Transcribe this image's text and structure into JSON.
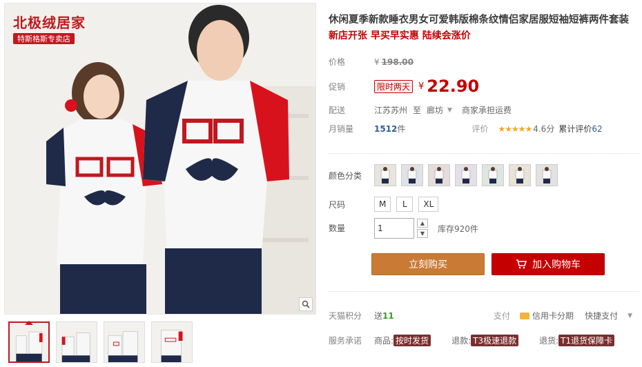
{
  "brand": {
    "name": "北极绒居家",
    "store": "特斯格斯专卖店"
  },
  "product": {
    "title": "休闲夏季新款睡衣男女可爱韩版棉条纹情侣家居服短袖短裤两件套装",
    "promo_line": "新店开张 早买早实惠 陆续会涨价"
  },
  "price": {
    "label": "价格",
    "currency": "¥",
    "original": "198.00"
  },
  "promo": {
    "label": "促销",
    "tag": "限时两天",
    "currency": "¥",
    "value": "22.90"
  },
  "shipping": {
    "label": "配送",
    "from": "江苏苏州",
    "to_word": "至",
    "to": "廊坊",
    "fee": "商家承担运费"
  },
  "sales": {
    "label": "月销量",
    "count": "1512",
    "unit": "件",
    "rating_label": "评价",
    "stars": "★★★★★",
    "score": "4.6分",
    "reviews_label": "累计评价",
    "reviews_count": "62"
  },
  "color": {
    "label": "颜色分类",
    "swatch_count": 7
  },
  "size": {
    "label": "尺码",
    "options": [
      "M",
      "L",
      "XL"
    ]
  },
  "quantity": {
    "label": "数量",
    "value": "1",
    "up": "▲",
    "down": "▼",
    "stock": "库存920件"
  },
  "actions": {
    "buy": "立刻购买",
    "cart": "加入购物车"
  },
  "points": {
    "label": "天猫积分",
    "send": "送",
    "value": "11",
    "pay_label": "支付",
    "credit": "信用卡分期",
    "quick_pay": "快捷支付"
  },
  "service": {
    "label": "服务承诺",
    "goods": "商品:",
    "goods_tag": "按时发货",
    "refund": "退款:",
    "refund_tag": "T3极速退款",
    "return": "退货:",
    "return_tag": "T1退货保障卡"
  },
  "colors": {
    "accent": "#c40000",
    "buy": "#c97a35",
    "brand": "#c0181f"
  },
  "icons": {
    "zoom": "magnifier-icon",
    "cart": "cart-icon",
    "dropdown": "chevron-down-icon"
  }
}
